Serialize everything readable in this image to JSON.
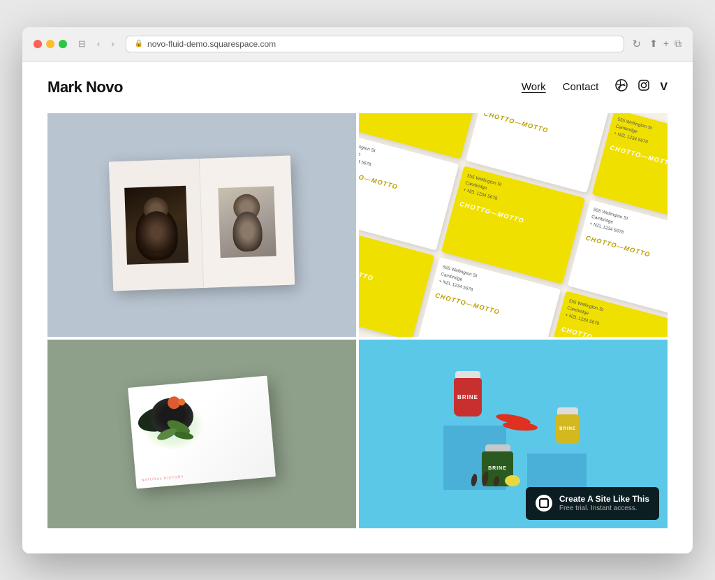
{
  "browser": {
    "url": "novo-fluid-demo.squarespace.com",
    "back_label": "‹",
    "forward_label": "›",
    "refresh_label": "↻",
    "share_label": "⬆",
    "new_tab_label": "+",
    "copy_label": "⧉"
  },
  "site": {
    "logo": "Mark Novo",
    "nav": {
      "work_label": "Work",
      "contact_label": "Contact"
    },
    "icons": {
      "dribbble": "⊛",
      "instagram": "◻",
      "vimeo": "V"
    }
  },
  "portfolio": {
    "items": [
      {
        "id": "book",
        "alt": "Open book with black and white portraits on blue-gray background"
      },
      {
        "id": "cards",
        "alt": "Yellow and white business cards with Chotto Motto branding arranged at angle"
      },
      {
        "id": "bird-book",
        "alt": "White book with colorful bird illustration on sage green background"
      },
      {
        "id": "jars",
        "alt": "BRINE branded pickle jars on blue background with peppers and lemon"
      }
    ]
  },
  "banner": {
    "main_text": "Create A Site Like This",
    "sub_text": "Free trial. Instant access."
  },
  "cards_data": [
    {
      "type": "yellow"
    },
    {
      "type": "white"
    },
    {
      "type": "yellow"
    },
    {
      "type": "white"
    },
    {
      "type": "yellow"
    },
    {
      "type": "white"
    },
    {
      "type": "yellow"
    },
    {
      "type": "white"
    },
    {
      "type": "yellow"
    }
  ]
}
